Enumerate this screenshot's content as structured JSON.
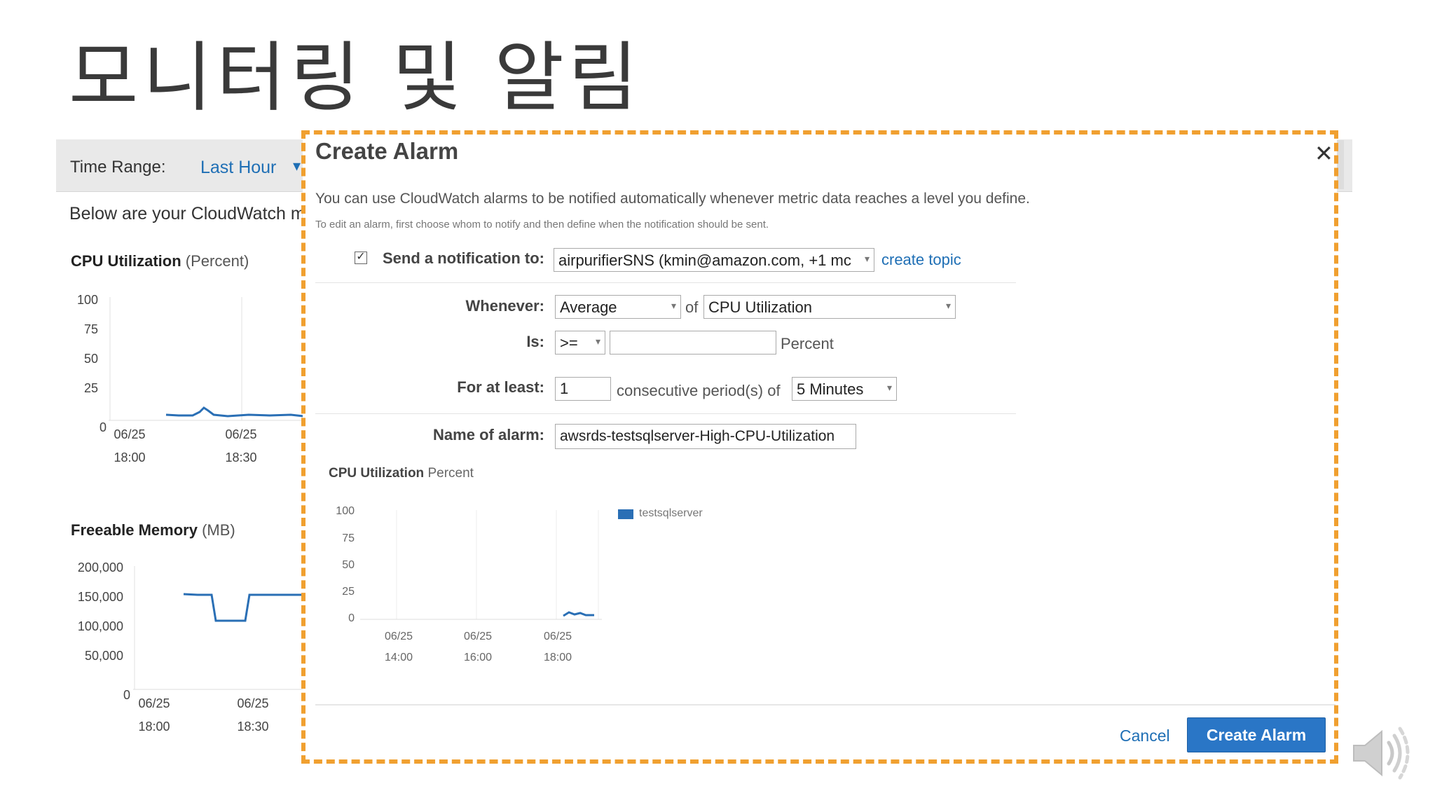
{
  "slide": {
    "title": "모니터링 및 알림"
  },
  "background": {
    "time_range_label": "Time Range:",
    "time_range_value": "Last Hour",
    "description": "Below are your CloudWatch m",
    "cpu_chart": {
      "title": "CPU Utilization",
      "unit": "(Percent)",
      "y_ticks": [
        "100",
        "75",
        "50",
        "25",
        "0"
      ],
      "x_ticks": [
        [
          "06/25",
          "18:00"
        ],
        [
          "06/25",
          "18:30"
        ]
      ]
    },
    "memory_chart": {
      "title": "Freeable Memory",
      "unit": "(MB)",
      "y_ticks": [
        "200,000",
        "150,000",
        "100,000",
        "50,000",
        "0"
      ],
      "x_ticks": [
        [
          "06/25",
          "18:00"
        ],
        [
          "06/25",
          "18:30"
        ]
      ]
    }
  },
  "dialog": {
    "title": "Create Alarm",
    "close": "✕",
    "description": "You can use CloudWatch alarms to be notified automatically whenever metric data reaches a level you define.",
    "subtext": "To edit an alarm, first choose whom to notify and then define when the notification should be sent.",
    "notification": {
      "checked": true,
      "label": "Send a notification to:",
      "value": "airpurifierSNS (kmin@amazon.com, +1 mc",
      "create_topic": "create topic"
    },
    "whenever": {
      "label": "Whenever:",
      "statistic": "Average",
      "of": "of",
      "metric": "CPU Utilization"
    },
    "is": {
      "label": "Is:",
      "operator": ">=",
      "value": "",
      "unit": "Percent"
    },
    "for_at_least": {
      "label": "For at least:",
      "value": "1",
      "text": "consecutive period(s) of",
      "period": "5 Minutes"
    },
    "name": {
      "label": "Name of alarm:",
      "value": "awsrds-testsqlserver-High-CPU-Utilization"
    },
    "chart": {
      "title": "CPU Utilization",
      "unit": "Percent",
      "y_ticks": [
        "100",
        "75",
        "50",
        "25",
        "0"
      ],
      "x_ticks": [
        [
          "06/25",
          "14:00"
        ],
        [
          "06/25",
          "16:00"
        ],
        [
          "06/25",
          "18:00"
        ]
      ],
      "legend": "testsqlserver"
    },
    "cancel": "Cancel",
    "create": "Create Alarm"
  },
  "colors": {
    "accent": "#1f6fb5",
    "button": "#2a76c6",
    "outline": "#f0a030",
    "series": "#2a6fb5"
  },
  "icons": {
    "speaker": "speaker-icon",
    "checkbox": "checkbox-icon"
  }
}
